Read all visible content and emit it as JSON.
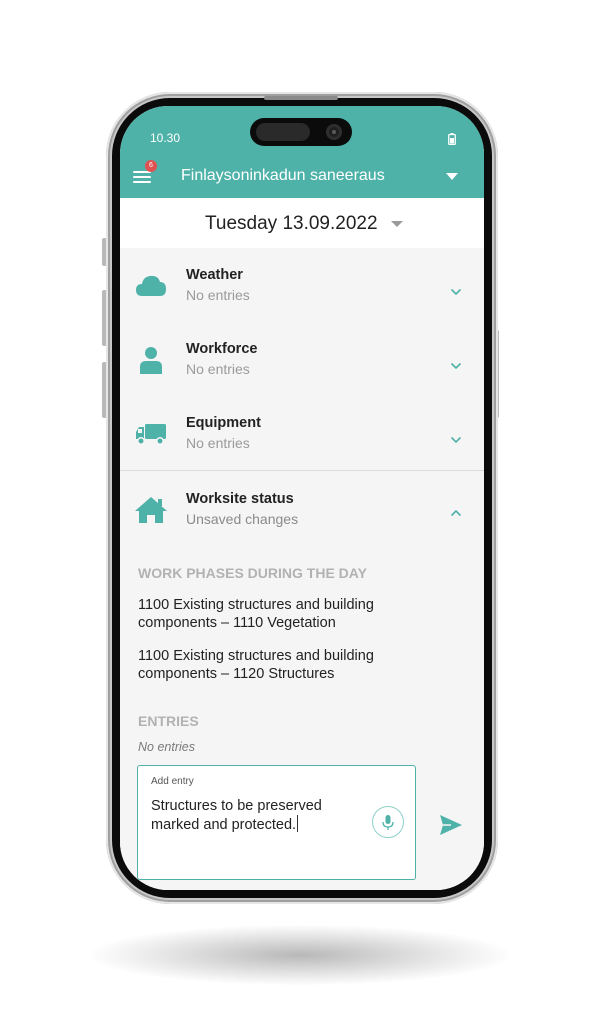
{
  "status_bar": {
    "time": "10.30",
    "battery_icon": "battery-icon"
  },
  "app_bar": {
    "menu_icon": "menu-icon",
    "notification_count": "6",
    "project_title": "Finlaysoninkadun saneeraus",
    "dropdown_icon": "caret-down-icon"
  },
  "date_bar": {
    "date": "Tuesday 13.09.2022",
    "dropdown_icon": "caret-down-icon"
  },
  "sections": [
    {
      "title": "Weather",
      "subtitle": "No entries",
      "icon": "cloud-icon",
      "expanded": false
    },
    {
      "title": "Workforce",
      "subtitle": "No entries",
      "icon": "person-icon",
      "expanded": false
    },
    {
      "title": "Equipment",
      "subtitle": "No entries",
      "icon": "truck-icon",
      "expanded": false
    }
  ],
  "worksite": {
    "title": "Worksite status",
    "subtitle": "Unsaved changes",
    "icon": "house-icon",
    "expanded": true,
    "phases_heading": "WORK PHASES DURING THE DAY",
    "phases": [
      "1100 Existing structures and building components – 1110 Vegetation",
      "1100 Existing structures and building components – 1120 Structures"
    ],
    "entries_heading": "ENTRIES",
    "entries_empty": "No entries",
    "entry_input": {
      "label": "Add entry",
      "value": "Structures to be preserved marked and protected."
    },
    "mic_icon": "microphone-icon",
    "send_icon": "send-icon"
  },
  "colors": {
    "accent": "#4fb2a9",
    "background": "#f5f5f5",
    "badge": "#e05252",
    "heading_muted": "#b2b2b2"
  }
}
